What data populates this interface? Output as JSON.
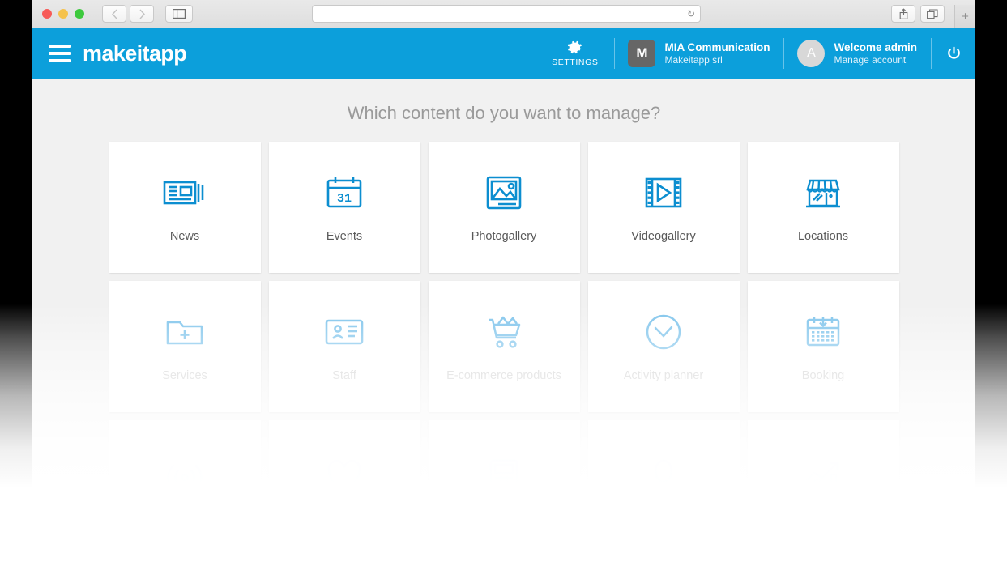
{
  "browser": {
    "traffic_lights": [
      "close",
      "minimize",
      "maximize"
    ],
    "back_label": "‹",
    "forward_label": "›",
    "sidebar_icon": "sidebar-icon",
    "url_value": "",
    "url_placeholder": "",
    "reload_icon": "↻",
    "share_icon": "⇧",
    "tabs_icon": "⧉",
    "newtab_label": "+"
  },
  "header": {
    "logo": "makeitapp",
    "menu_icon": "hamburger-icon",
    "settings": {
      "label": "SETTINGS",
      "icon": "gear-icon"
    },
    "organization": {
      "initial": "M",
      "name": "MIA Communication",
      "subtitle": "Makeitapp srl"
    },
    "account": {
      "initial": "A",
      "name": "Welcome admin",
      "subtitle": "Manage account"
    },
    "power": {
      "icon": "power-icon"
    }
  },
  "main": {
    "title": "Which content do you want to manage?",
    "rows": [
      {
        "state": "active",
        "cards": [
          {
            "label": "News",
            "icon": "newspaper-icon"
          },
          {
            "label": "Events",
            "icon": "calendar-31-icon"
          },
          {
            "label": "Photogallery",
            "icon": "image-icon"
          },
          {
            "label": "Videogallery",
            "icon": "film-play-icon"
          },
          {
            "label": "Locations",
            "icon": "storefront-icon"
          }
        ]
      },
      {
        "state": "faded",
        "cards": [
          {
            "label": "Services",
            "icon": "folder-plus-icon"
          },
          {
            "label": "Staff",
            "icon": "id-card-icon"
          },
          {
            "label": "E-commerce products",
            "icon": "shopping-cart-icon"
          },
          {
            "label": "Activity planner",
            "icon": "clock-icon"
          },
          {
            "label": "Booking",
            "icon": "calendar-download-icon"
          }
        ]
      },
      {
        "state": "ghost",
        "cards": [
          {
            "label": "",
            "icon": "beacon-signal-icon"
          },
          {
            "label": "",
            "icon": "heart-icon"
          },
          {
            "label": "",
            "icon": "calculator-icon"
          },
          {
            "label": "",
            "icon": "person-icon"
          },
          {
            "label": "",
            "icon": "growth-chart-icon"
          }
        ]
      }
    ]
  },
  "colors": {
    "brand_blue": "#0c9fdb",
    "icon_blue": "#0c8ed0",
    "page_bg": "#f1f1f1",
    "card_bg": "#ffffff",
    "title_gray": "#9a9a9a",
    "label_gray": "#595959",
    "faded_gray": "#c9c9c9",
    "org_badge": "#666666"
  }
}
